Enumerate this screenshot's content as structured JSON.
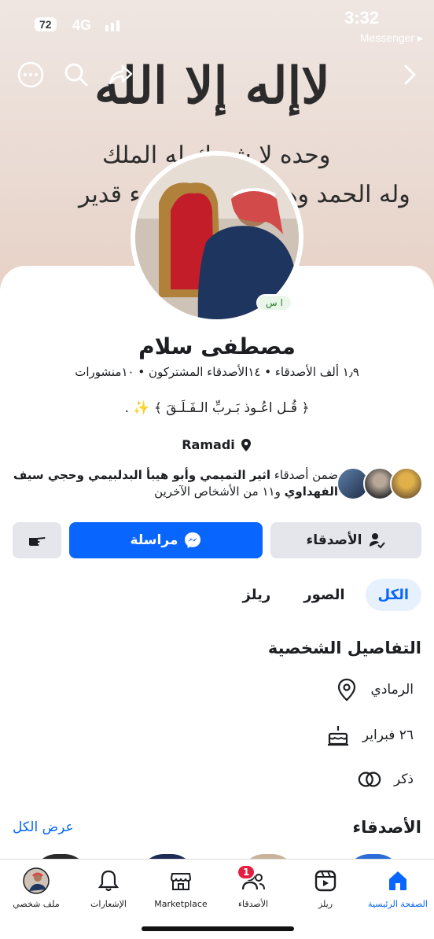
{
  "status_bar": {
    "battery": "72",
    "network": "4G",
    "time": "3:32",
    "back_app": "Messenger ▸"
  },
  "cover": {
    "line1": "لاإله إلا الله",
    "line2": "وحده لا شريك له الملك",
    "line3": "وله الحمد وهو على كل شيء قدير"
  },
  "profile": {
    "badge": "ا س",
    "name": "مصطفى سلام",
    "stats": "١٫٩ ألف الأصدقاء • ١٤الأصدقاء المشتركون • ١٠منشورات",
    "bio": "﴿ قُـل اعُـوذ بَـربِّ الـفَـلَـقَ ﴾ ✨ .",
    "location": "Ramadi"
  },
  "mutual": {
    "prefix": "ضمن أصدقاء",
    "names": "اثير التميمي وأبو هيبأ البدلبيمي وحجي سيف الفهداوي",
    "suffix": "و١١ من الأشخاص الآخرين"
  },
  "actions": {
    "friends": "الأصدقاء",
    "message": "مراسلة"
  },
  "tabs": [
    {
      "label": "الكل"
    },
    {
      "label": "الصور"
    },
    {
      "label": "ريلز"
    }
  ],
  "details": {
    "title": "التفاصيل الشخصية",
    "items": [
      {
        "icon": "location-pin-icon",
        "text": "الرمادي"
      },
      {
        "icon": "birthday-cake-icon",
        "text": "٢٦ فبراير"
      },
      {
        "icon": "gender-rings-icon",
        "text": "ذكر"
      }
    ]
  },
  "friends_section": {
    "title": "الأصدقاء",
    "see_all": "عرض الكل"
  },
  "bottom_nav": [
    {
      "label": "الصفحة الرئيسية",
      "icon": "home-icon",
      "active": true
    },
    {
      "label": "ريلز",
      "icon": "reels-icon"
    },
    {
      "label": "الأصدقاء",
      "icon": "friends-icon",
      "badge": "1"
    },
    {
      "label": "Marketplace",
      "icon": "marketplace-icon"
    },
    {
      "label": "الإشعارات",
      "icon": "bell-icon"
    },
    {
      "label": "ملف شخصي",
      "icon": "profile-avatar-icon"
    }
  ],
  "colors": {
    "accent": "#0866ff",
    "badge": "#e41e3f"
  }
}
